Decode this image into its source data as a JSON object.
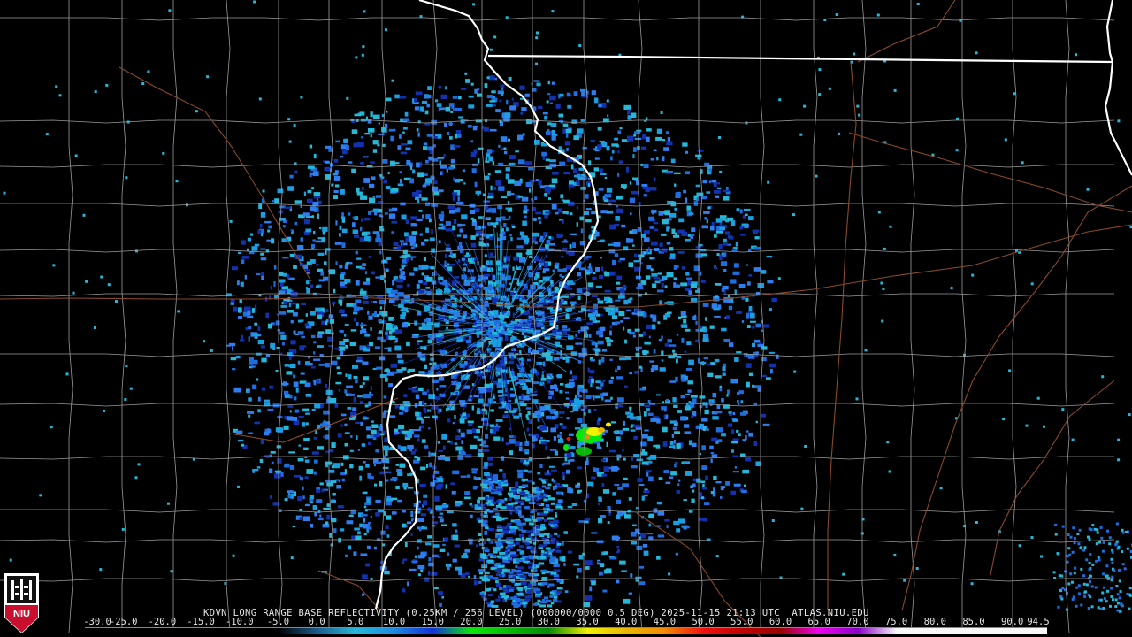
{
  "product": {
    "caption": "KDVN LONG RANGE BASE REFLECTIVITY (0.25KM / 256 LEVEL) (000000/0000 0.5 DEG) 2025-11-15 21:13 UTC  ATLAS.NIU.EDU",
    "station": "KDVN",
    "timestamp": "2025-11-15 21:13 UTC",
    "source": "ATLAS.NIU.EDU"
  },
  "logo": {
    "text": "NIU",
    "name": "niu-logo"
  },
  "colorscale": {
    "ticks": [
      "-30.0",
      "-25.0",
      "-20.0",
      "-15.0",
      "-10.0",
      "-5.0",
      "0.0",
      "5.0",
      "10.0",
      "15.0",
      "20.0",
      "25.0",
      "30.0",
      "35.0",
      "40.0",
      "45.0",
      "50.0",
      "55.0",
      "60.0",
      "65.0",
      "70.0",
      "75.0",
      "80.0",
      "85.0",
      "90.0",
      "94.5"
    ],
    "values": [
      -30,
      -25,
      -20,
      -15,
      -10,
      -5,
      0,
      5,
      10,
      15,
      20,
      25,
      30,
      35,
      40,
      45,
      50,
      55,
      60,
      65,
      70,
      75,
      80,
      85,
      90,
      94.5
    ],
    "colors": [
      "#000000",
      "#000000",
      "#000000",
      "#000000",
      "#000000",
      "#000000",
      "#1a5a8a",
      "#26b8d8",
      "#1e8ae0",
      "#1232d8",
      "#08e808",
      "#06b806",
      "#048a04",
      "#f4f000",
      "#e8b800",
      "#f48a00",
      "#f41010",
      "#c00000",
      "#980000",
      "#f000f0",
      "#8800c8",
      "#f8f8f8",
      "#f8f8f8",
      "#f8f8f8",
      "#f8f8f8",
      "#f8f8f8"
    ]
  },
  "colors": {
    "background": "#000000",
    "county_lines": "#9a9a9a",
    "state_lines": "#ffffff",
    "roads": "#8a4a2c",
    "radar_light": "#26b8d8",
    "radar_mid": "#1e6ee0",
    "radar_dark": "#1232b0"
  },
  "radar": {
    "center_cell": "DVN",
    "storm_max_dbz": 50
  }
}
